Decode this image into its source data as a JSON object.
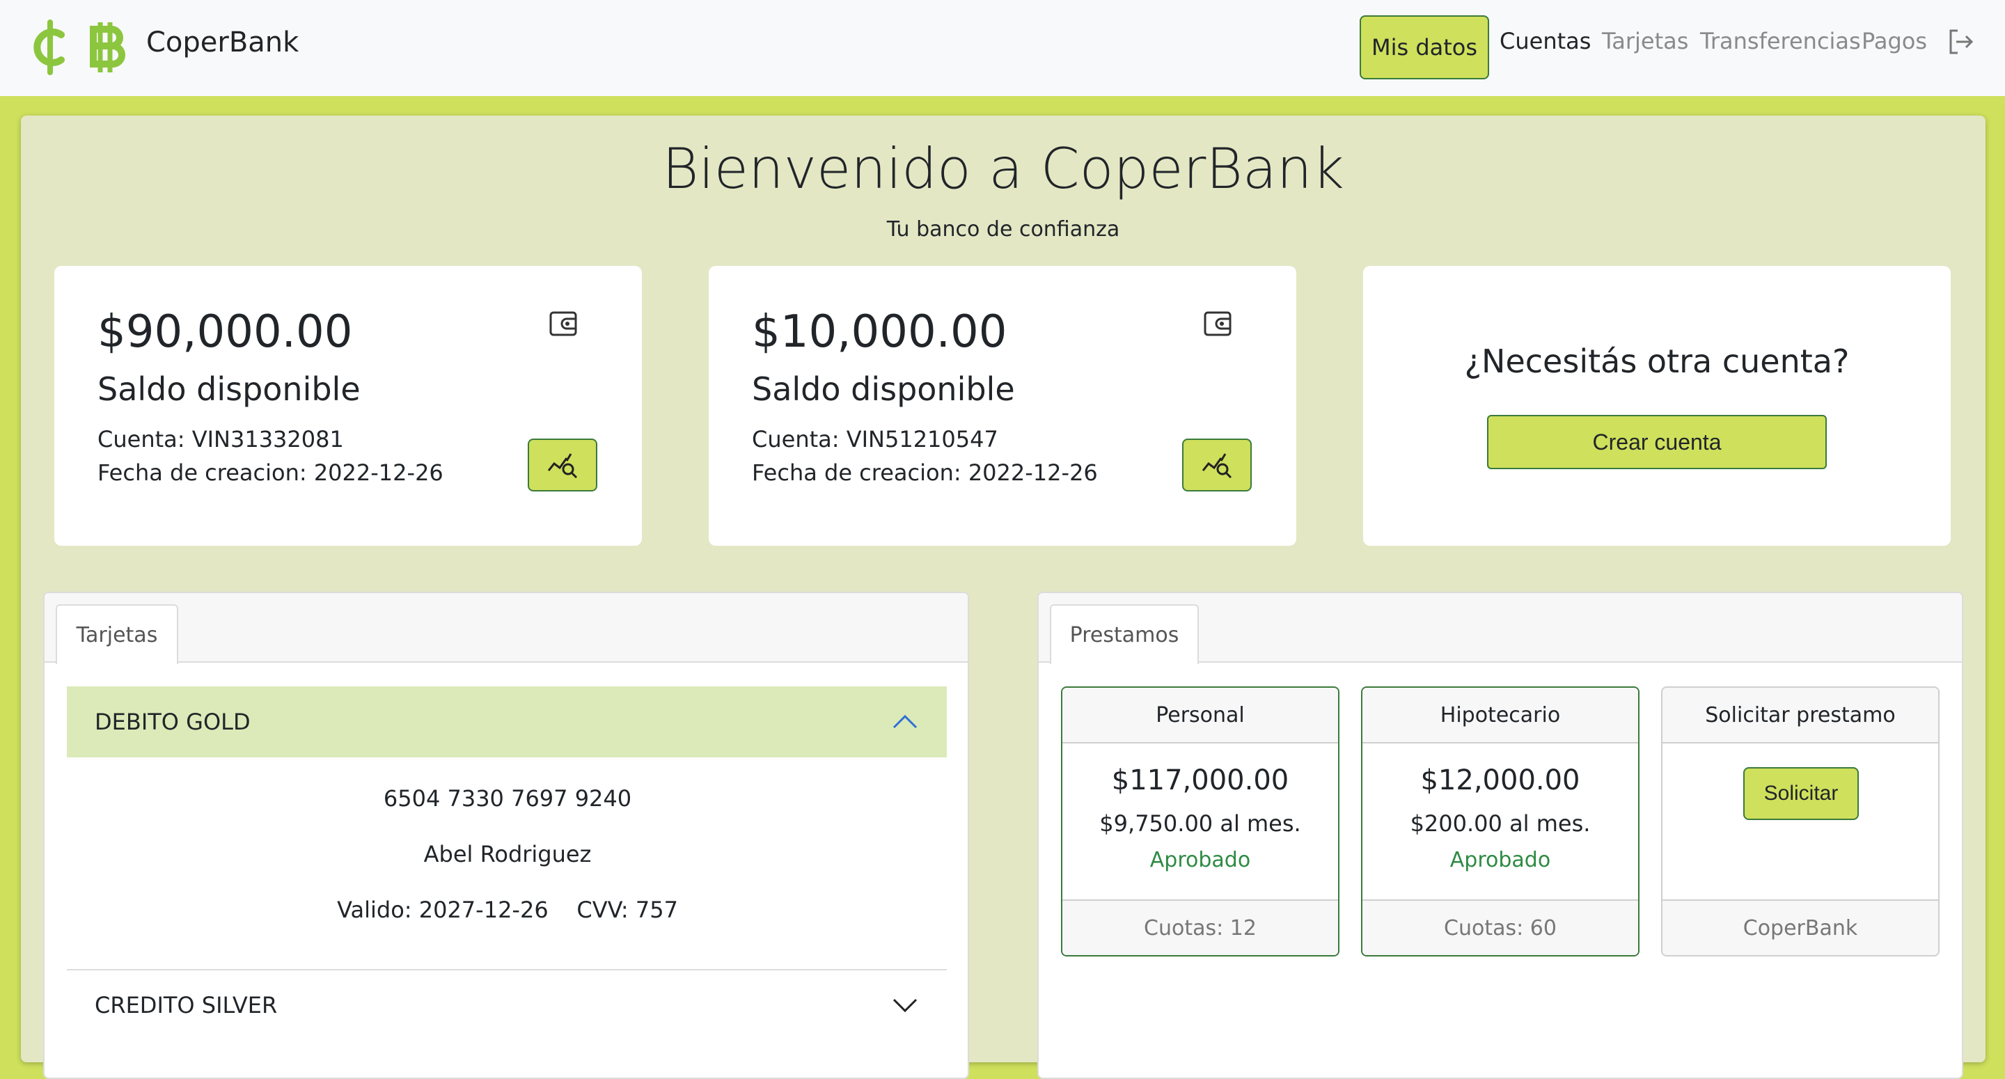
{
  "brand": {
    "name": "CoperBank",
    "icons": [
      "cent-icon",
      "bitcoin-icon"
    ],
    "color": "#8cc63f"
  },
  "nav": {
    "mis_datos": "Mis datos",
    "links": [
      "Cuentas",
      "Tarjetas",
      "Transferencias",
      "Pagos"
    ],
    "active": "Cuentas",
    "logout_icon": "logout-icon"
  },
  "hero": {
    "title": "Bienvenido a CoperBank",
    "subtitle": "Tu banco de confianza"
  },
  "accounts": [
    {
      "amount": "$90,000.00",
      "label": "Saldo disponible",
      "number": "Cuenta: VIN31332081",
      "date": "Fecha de creacion: 2022-12-26"
    },
    {
      "amount": "$10,000.00",
      "label": "Saldo disponible",
      "number": "Cuenta: VIN51210547",
      "date": "Fecha de creacion: 2022-12-26"
    }
  ],
  "new_account": {
    "title": "¿Necesitás otra cuenta?",
    "button": "Crear cuenta"
  },
  "cards_panel": {
    "tab": "Tarjetas",
    "open_card": {
      "title": "DEBITO GOLD",
      "number": "6504 7330 7697 9240",
      "holder": "Abel Rodriguez",
      "valid": "Valido: 2027-12-26    CVV: 757"
    },
    "closed_card": {
      "title": "CREDITO SILVER"
    }
  },
  "loans_panel": {
    "tab": "Prestamos",
    "loans": [
      {
        "name": "Personal",
        "amount": "$117,000.00",
        "monthly": "$9,750.00 al mes.",
        "status": "Aprobado",
        "footer": "Cuotas: 12"
      },
      {
        "name": "Hipotecario",
        "amount": "$12,000.00",
        "monthly": "$200.00 al mes.",
        "status": "Aprobado",
        "footer": "Cuotas: 60"
      }
    ],
    "request": {
      "title": "Solicitar prestamo",
      "button": "Solicitar",
      "footer": "CoperBank"
    }
  },
  "colors": {
    "accent": "#cfe05c",
    "border_green": "#3b7a3b",
    "status_green": "#2e8b43",
    "panel_bg": "#e3e7c4"
  }
}
